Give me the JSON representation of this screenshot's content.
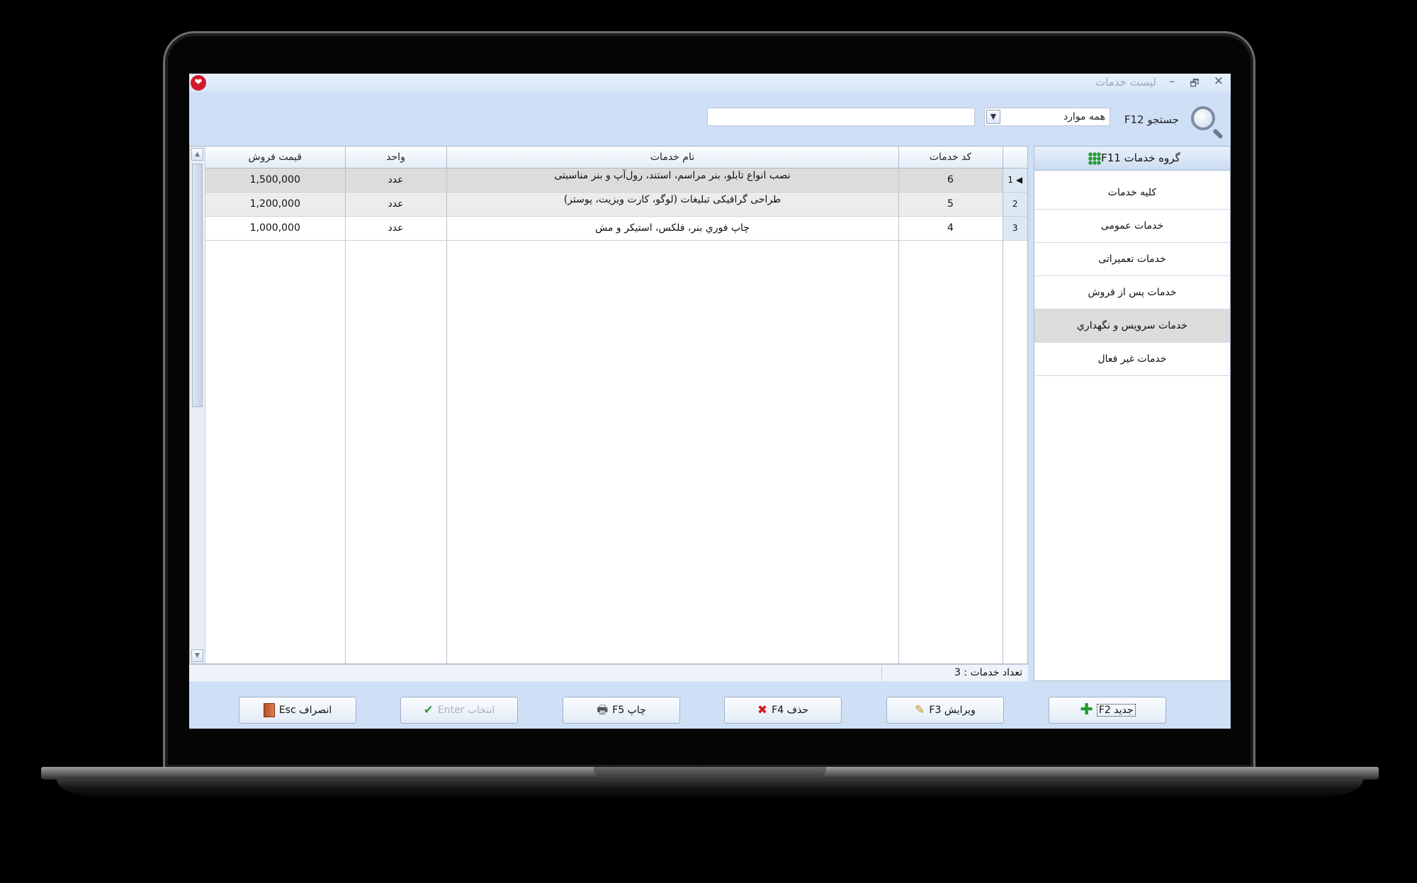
{
  "window": {
    "title": "لیست خدمات",
    "minimize": "–",
    "maximize": "🗗",
    "close": "✕",
    "logo": "❤"
  },
  "search": {
    "label": "جستجو F12",
    "scope": "همه موارد",
    "input_value": "",
    "dropdown_arrow": "▼"
  },
  "table": {
    "columns": [
      "کد خدمات",
      "نام خدمات",
      "واحد",
      "قیمت فروش"
    ],
    "rows": [
      {
        "index": "1",
        "indicator": "◀",
        "code": "6",
        "name": "نصب انواع تابلو، بنر مراسم، استند، رول‌آپ و بنر مناسبتی",
        "unit": "عدد",
        "price": "1,500,000"
      },
      {
        "index": "2",
        "indicator": "",
        "code": "5",
        "name": "طراحی گرافیکی تبلیغات (لوگو، کارت ویزیت، پوستر)",
        "unit": "عدد",
        "price": "1,200,000"
      },
      {
        "index": "3",
        "indicator": "",
        "code": "4",
        "name": "چاپ فوري بنر، فلکس، استیکر و مش",
        "unit": "عدد",
        "price": "1,000,000"
      }
    ]
  },
  "status": {
    "count_text": "تعداد خدمات : 3"
  },
  "sidebar": {
    "header": "گروه خدمات F11",
    "items": [
      {
        "label": "کلیه خدمات"
      },
      {
        "label": "خدمات عمومی"
      },
      {
        "label": "خدمات تعمیراتی"
      },
      {
        "label": "خدمات پس از فروش"
      },
      {
        "label": "خدمات سرویس و نگهداري"
      },
      {
        "label": "خدمات غیر فعال"
      }
    ],
    "active_index": 4
  },
  "toolbar": {
    "new_label": "جدید F2",
    "edit_label": "ویرایش F3",
    "delete_label": "حذف F4",
    "print_label": "چاپ F5",
    "select_label": "انتخاب Enter",
    "cancel_label": "انصراف Esc",
    "icons": {
      "new": "✚",
      "edit": "✎",
      "delete": "✖",
      "print": "🖶",
      "select": "✔"
    }
  },
  "colors": {
    "chrome": "#cfe0f6",
    "selected_row": "#dcdcdc",
    "accent_green": "#1e9b2d",
    "delete_red": "#d11e1e"
  }
}
